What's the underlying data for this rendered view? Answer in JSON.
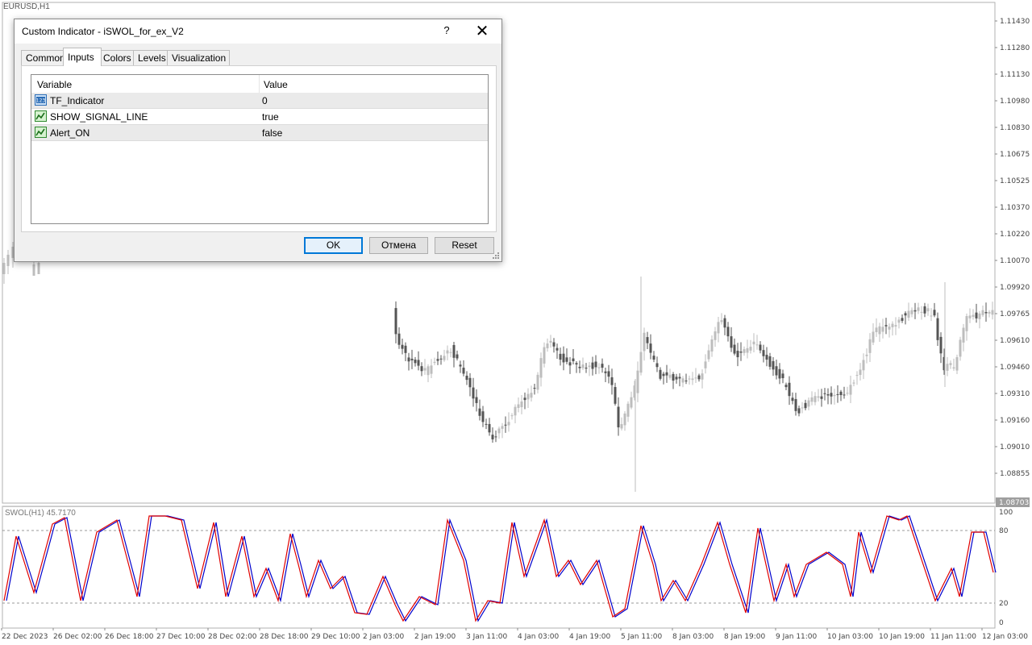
{
  "chart": {
    "symbol_label": "EURUSD,H1",
    "price_labels": [
      "1.11430",
      "1.11280",
      "1.11130",
      "1.10980",
      "1.10830",
      "1.10675",
      "1.10525",
      "1.10370",
      "1.10220",
      "1.10070",
      "1.09920",
      "1.09765",
      "1.09610",
      "1.09460",
      "1.09310",
      "1.09160",
      "1.09010",
      "1.08855"
    ],
    "current_price": "1.08703",
    "time_labels": [
      "22 Dec 2023",
      "26 Dec 02:00",
      "26 Dec 18:00",
      "27 Dec 10:00",
      "28 Dec 02:00",
      "28 Dec 18:00",
      "29 Dec 10:00",
      "2 Jan 03:00",
      "2 Jan 19:00",
      "3 Jan 11:00",
      "4 Jan 03:00",
      "4 Jan 19:00",
      "5 Jan 11:00",
      "8 Jan 03:00",
      "8 Jan 19:00",
      "9 Jan 11:00",
      "10 Jan 03:00",
      "10 Jan 19:00",
      "11 Jan 11:00",
      "12 Jan 03:00"
    ],
    "oscillator_label": "SWOL(H1) 45.7170",
    "oscillator_levels": [
      "100",
      "80",
      "20",
      "0"
    ]
  },
  "dialog": {
    "title": "Custom Indicator - iSWOL_for_ex_V2",
    "help_label": "?",
    "close_label": "✕",
    "tabs": [
      "Common",
      "Inputs",
      "Colors",
      "Levels",
      "Visualization"
    ],
    "active_tab": "Inputs",
    "columns": [
      "Variable",
      "Value"
    ],
    "rows": [
      {
        "name": "TF_Indicator",
        "value": "0",
        "icon": "numeric-123-icon"
      },
      {
        "name": "SHOW_SIGNAL_LINE",
        "value": "true",
        "icon": "boolean-chart-icon"
      },
      {
        "name": "Alert_ON",
        "value": "false",
        "icon": "boolean-chart-icon"
      }
    ],
    "buttons": {
      "ok": "OK",
      "cancel": "Отмена",
      "reset": "Reset"
    }
  },
  "colors": {
    "signal_red": "#e00000",
    "main_blue": "#0000cc",
    "candle_dark": "#555555",
    "candle_light": "#bdbdbd",
    "focus_blue": "#0078d7"
  }
}
